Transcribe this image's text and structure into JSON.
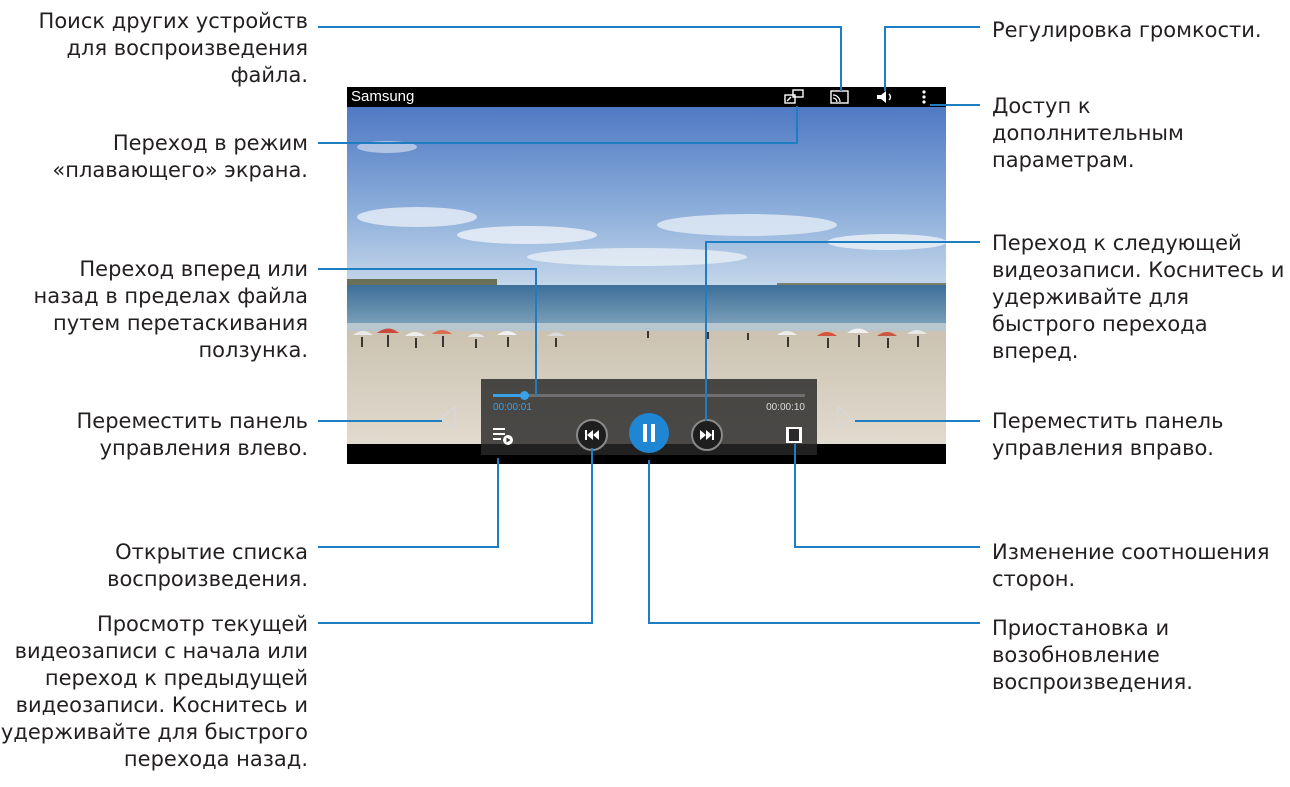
{
  "player": {
    "title": "Samsung",
    "current_time": "00:00:01",
    "total_time": "00:00:10",
    "progress_fraction": 0.1
  },
  "annotations": {
    "find_devices": "Поиск других устройств для воспроизведения файла.",
    "popup_mode": "Переход в режим «плавающего» экрана.",
    "seek": "Переход вперед или назад в пределах файла путем перетаскивания ползунка.",
    "move_left": "Переместить панель управления влево.",
    "playlist": "Открытие списка воспроизведения.",
    "previous": "Просмотр текущей видеозаписи с начала или переход к предыдущей видеозаписи. Коснитесь и удерживайте для быстрого перехода назад.",
    "volume": "Регулировка громкости.",
    "more_options": "Доступ к дополнительным параметрам.",
    "next": "Переход к следующей видеозаписи. Коснитесь и удерживайте для быстрого перехода вперед.",
    "move_right": "Переместить панель управления вправо.",
    "aspect_ratio": "Изменение соотношения сторон.",
    "pause_resume": "Приостановка и возобновление воспроизведения."
  },
  "icons": {
    "popup": "popup-screen-icon",
    "cast": "screen-mirroring-icon",
    "volume": "speaker-icon",
    "more": "more-options-icon",
    "playlist": "playlist-icon",
    "previous": "previous-track-icon",
    "pause": "pause-icon",
    "next": "next-track-icon",
    "ratio": "aspect-ratio-icon",
    "left": "left-arrow-icon",
    "right": "right-arrow-icon"
  },
  "colors": {
    "connector": "#1f7ec1",
    "accent": "#1f86d3"
  }
}
